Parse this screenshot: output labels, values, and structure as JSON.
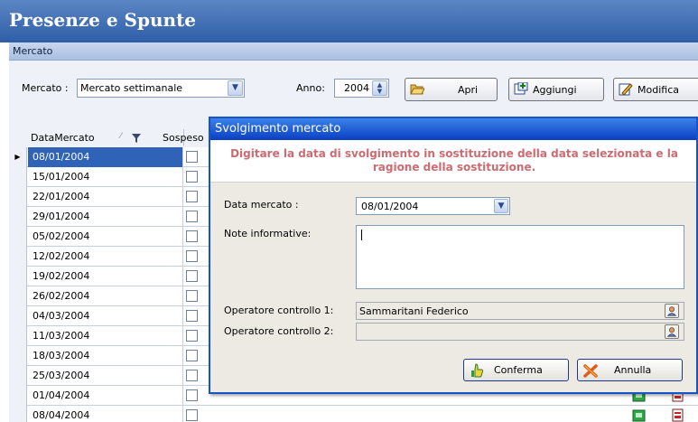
{
  "app": {
    "title": "Presenze e Spunte"
  },
  "section": {
    "label": "Mercato"
  },
  "toolbar": {
    "mercato_label": "Mercato :",
    "mercato_value": "Mercato settimanale",
    "anno_label": "Anno:",
    "anno_value": "2004",
    "apri_label": "Apri",
    "aggiungi_label": "Aggiungi",
    "modifica_label": "Modifica"
  },
  "grid": {
    "columns": {
      "data_mercato": "DataMercato",
      "sospeso": "Sospeso"
    },
    "rows": [
      "08/01/2004",
      "15/01/2004",
      "22/01/2004",
      "29/01/2004",
      "05/02/2004",
      "12/02/2004",
      "19/02/2004",
      "26/02/2004",
      "04/03/2004",
      "11/03/2004",
      "18/03/2004",
      "25/03/2004",
      "01/04/2004",
      "08/04/2004"
    ],
    "selected_index": 0
  },
  "dialog": {
    "title": "Svolgimento mercato",
    "message": "Digitare la data di svolgimento in sostituzione della data selezionata e la ragione della sostituzione.",
    "data_mercato_label": "Data mercato :",
    "data_mercato_value": "08/01/2004",
    "note_label": "Note informative:",
    "note_value": "",
    "operatore1_label": "Operatore controllo 1:",
    "operatore1_value": "Sammaritani Federico",
    "operatore2_label": "Operatore controllo 2:",
    "operatore2_value": "",
    "conferma_label": "Conferma",
    "annulla_label": "Annulla"
  },
  "icons": {
    "apri": "folder-open-icon",
    "aggiungi": "add-record-icon",
    "modifica": "edit-icon",
    "conferma": "thumbs-up-icon",
    "annulla": "cancel-x-icon",
    "operator_picker": "user-search-icon",
    "row_presence": "green-card-icon",
    "row_print": "report-icon"
  },
  "colors": {
    "title_bar": "#2f5ea8",
    "selection": "#2f63b8",
    "dialog_title": "#0a3fc1",
    "message_text": "#cb6b72"
  }
}
